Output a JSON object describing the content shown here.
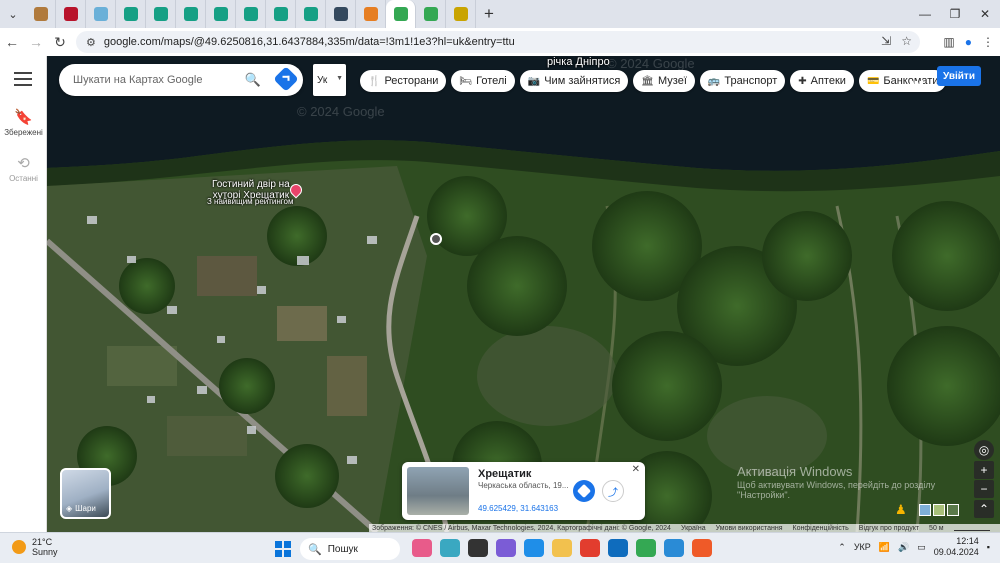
{
  "browser": {
    "url": "google.com/maps/@49.6250816,31.6437884,335m/data=!3m1!1e3?hl=uk&entry=ttu",
    "tab_favicon_colors": [
      "#b07a3c",
      "#b8132b",
      "#6ab0d8",
      "#16a085",
      "#16a085",
      "#16a085",
      "#16a085",
      "#16a085",
      "#16a085",
      "#16a085",
      "#34495e",
      "#e67e22",
      "#34a853",
      "#34a853",
      "#c9a400"
    ]
  },
  "maps": {
    "search_placeholder": "Шукати на Картах Google",
    "language_value": "Ук",
    "chips": [
      {
        "icon": "restaurant-icon",
        "glyph": "🍴",
        "label": "Ресторани"
      },
      {
        "icon": "hotel-icon",
        "glyph": "🛏",
        "label": "Готелі"
      },
      {
        "icon": "camera-icon",
        "glyph": "📷",
        "label": "Чим зайнятися"
      },
      {
        "icon": "museum-icon",
        "glyph": "🏛",
        "label": "Музеї"
      },
      {
        "icon": "transit-icon",
        "glyph": "🚌",
        "label": "Транспорт"
      },
      {
        "icon": "pharmacy-icon",
        "glyph": "✚",
        "label": "Аптеки"
      },
      {
        "icon": "atm-icon",
        "glyph": "💳",
        "label": "Банкомати"
      }
    ],
    "signin_label": "Увійти",
    "rail": {
      "saved_label": "Збережені",
      "recent_label": "Останні"
    },
    "labels": {
      "river": "річка Дніпро",
      "watermark": "© 2024 Google",
      "poi_title_line1": "Гостиний двір на",
      "poi_title_line2": "хуторі Хрещатик",
      "poi_subtitle": "З найвищим рейтингом"
    },
    "layers_label": "Шари",
    "place_card": {
      "title": "Хрещатик",
      "subtitle": "Черкаська область, 19...",
      "coordinates": "49.625429, 31.643163"
    },
    "attribution": {
      "imagery": "Зображення: © CNES / Airbus, Maxar Technologies, 2024, Картографічні дані: © Google, 2024",
      "country": "Україна",
      "terms": "Умови використання",
      "privacy": "Конфіденційність",
      "feedback": "Відгук про продукт",
      "scale": "50 м"
    },
    "activation": {
      "line1": "Активація Windows",
      "line2": "Щоб активувати Windows, перейдіть до розділу \"Настройки\"."
    }
  },
  "taskbar": {
    "temperature": "21°C",
    "condition": "Sunny",
    "search_label": "Пошук",
    "language": "УКР",
    "time": "12:14",
    "date": "09.04.2024",
    "app_colors": [
      "#e85b8a",
      "#3aa8c1",
      "#333333",
      "#7b5cd6",
      "#1f8ee8",
      "#f2c14e",
      "#e23d2e",
      "#0f6cbd",
      "#34a853",
      "#2a8bd6",
      "#ef5a28"
    ]
  }
}
